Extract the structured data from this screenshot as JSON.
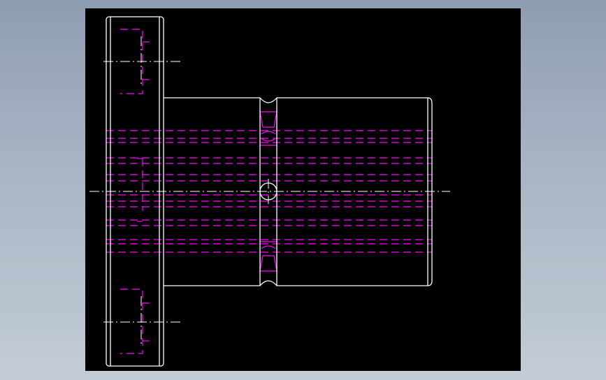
{
  "drawing": {
    "background_color": "#000000",
    "outline_color": "#ffffff",
    "hidden_line_color": "#ff00ff",
    "centerline_color": "#ffffff",
    "line_types": {
      "outline": "solid",
      "hidden": "dashed",
      "center": "dash-dot"
    },
    "views": [
      {
        "name": "flange-side-view",
        "hidden_holes": 2
      },
      {
        "name": "hub-side-view",
        "cross_hole": true,
        "groove": true
      }
    ]
  }
}
